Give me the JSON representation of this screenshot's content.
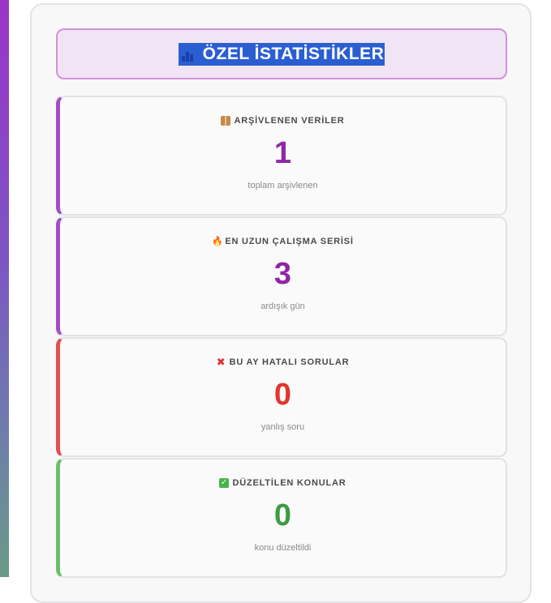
{
  "header": {
    "icon": "bar-chart-icon",
    "title": "ÖZEL İSTATİSTİKLER"
  },
  "cards": [
    {
      "icon": "package-icon",
      "label": "ARŞİVLENEN VERİLER",
      "value": "1",
      "sub": "toplam arşivlenen",
      "accent": "#a04fc4",
      "value_color": "#8e27a6"
    },
    {
      "icon": "fire-icon",
      "label": "EN UZUN ÇALIŞMA SERİSİ",
      "value": "3",
      "sub": "ardışık gün",
      "accent": "#a04fc4",
      "value_color": "#8e27a6"
    },
    {
      "icon": "cross-mark-icon",
      "label": "BU AY HATALI SORULAR",
      "value": "0",
      "sub": "yanlış soru",
      "accent": "#e05252",
      "value_color": "#e0362c"
    },
    {
      "icon": "check-mark-icon",
      "label": "DÜZELTİLEN KONULAR",
      "value": "0",
      "sub": "konu düzeltildi",
      "accent": "#6bbf6b",
      "value_color": "#3f9a43"
    }
  ]
}
